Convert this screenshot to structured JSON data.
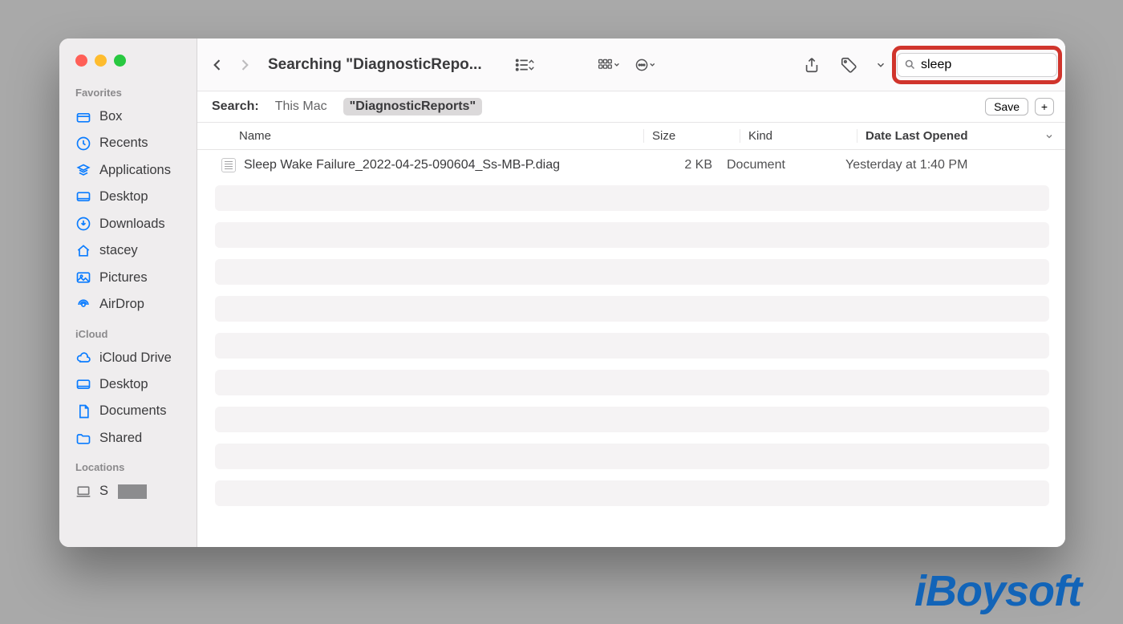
{
  "window": {
    "title": "Searching \"DiagnosticRepo..."
  },
  "traffic": {
    "close": "close",
    "minimize": "minimize",
    "zoom": "zoom"
  },
  "sidebar": {
    "sections": [
      {
        "heading": "Favorites",
        "items": [
          {
            "label": "Box",
            "icon": "box-icon"
          },
          {
            "label": "Recents",
            "icon": "clock-icon"
          },
          {
            "label": "Applications",
            "icon": "app-icon"
          },
          {
            "label": "Desktop",
            "icon": "desktop-icon"
          },
          {
            "label": "Downloads",
            "icon": "download-icon"
          },
          {
            "label": "stacey",
            "icon": "home-icon"
          },
          {
            "label": "Pictures",
            "icon": "picture-icon"
          },
          {
            "label": "AirDrop",
            "icon": "airdrop-icon"
          }
        ]
      },
      {
        "heading": "iCloud",
        "items": [
          {
            "label": "iCloud Drive",
            "icon": "icloud-icon"
          },
          {
            "label": "Desktop",
            "icon": "desktop-icon"
          },
          {
            "label": "Documents",
            "icon": "document-icon"
          },
          {
            "label": "Shared",
            "icon": "shared-folder-icon"
          }
        ]
      },
      {
        "heading": "Locations",
        "items": [
          {
            "label": "S",
            "icon": "laptop-icon",
            "redacted": true
          }
        ]
      }
    ]
  },
  "search": {
    "value": "sleep"
  },
  "scope": {
    "label": "Search:",
    "options": [
      "This Mac",
      "\"DiagnosticReports\""
    ],
    "active_index": 1,
    "save_label": "Save",
    "plus_label": "+"
  },
  "columns": {
    "name": "Name",
    "size": "Size",
    "kind": "Kind",
    "date": "Date Last Opened"
  },
  "results": [
    {
      "name": "Sleep Wake Failure_2022-04-25-090604_Ss-MB-P.diag",
      "size": "2 KB",
      "kind": "Document",
      "date": "Yesterday at 1:40 PM"
    }
  ],
  "watermark": "iBoysoft"
}
